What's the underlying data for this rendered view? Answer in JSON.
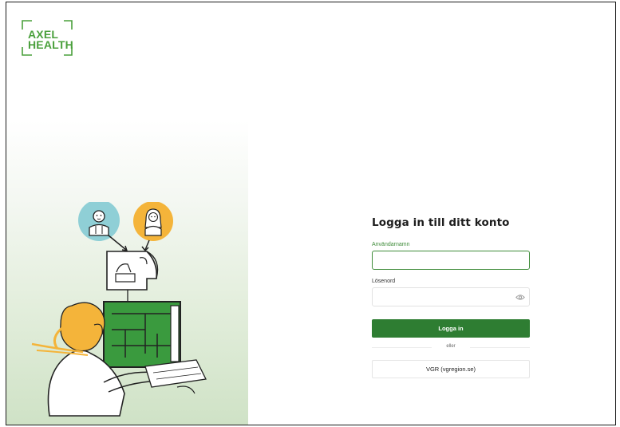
{
  "brand": {
    "logo_line1": "AXEL",
    "logo_line2": "HEALTH",
    "accent_color": "#4aa03c"
  },
  "login": {
    "title": "Logga in till ditt konto",
    "username_label": "Användarnamn",
    "username_value": "",
    "password_label": "Lösenord",
    "password_value": "",
    "show_password_icon": "eye-icon",
    "submit_label": "Logga in",
    "divider_text": "eller",
    "sso_label": "VGR (vgregion.se)",
    "primary_color": "#2e7d32"
  },
  "illustration": {
    "description_icon": "telehealth-illustration"
  }
}
